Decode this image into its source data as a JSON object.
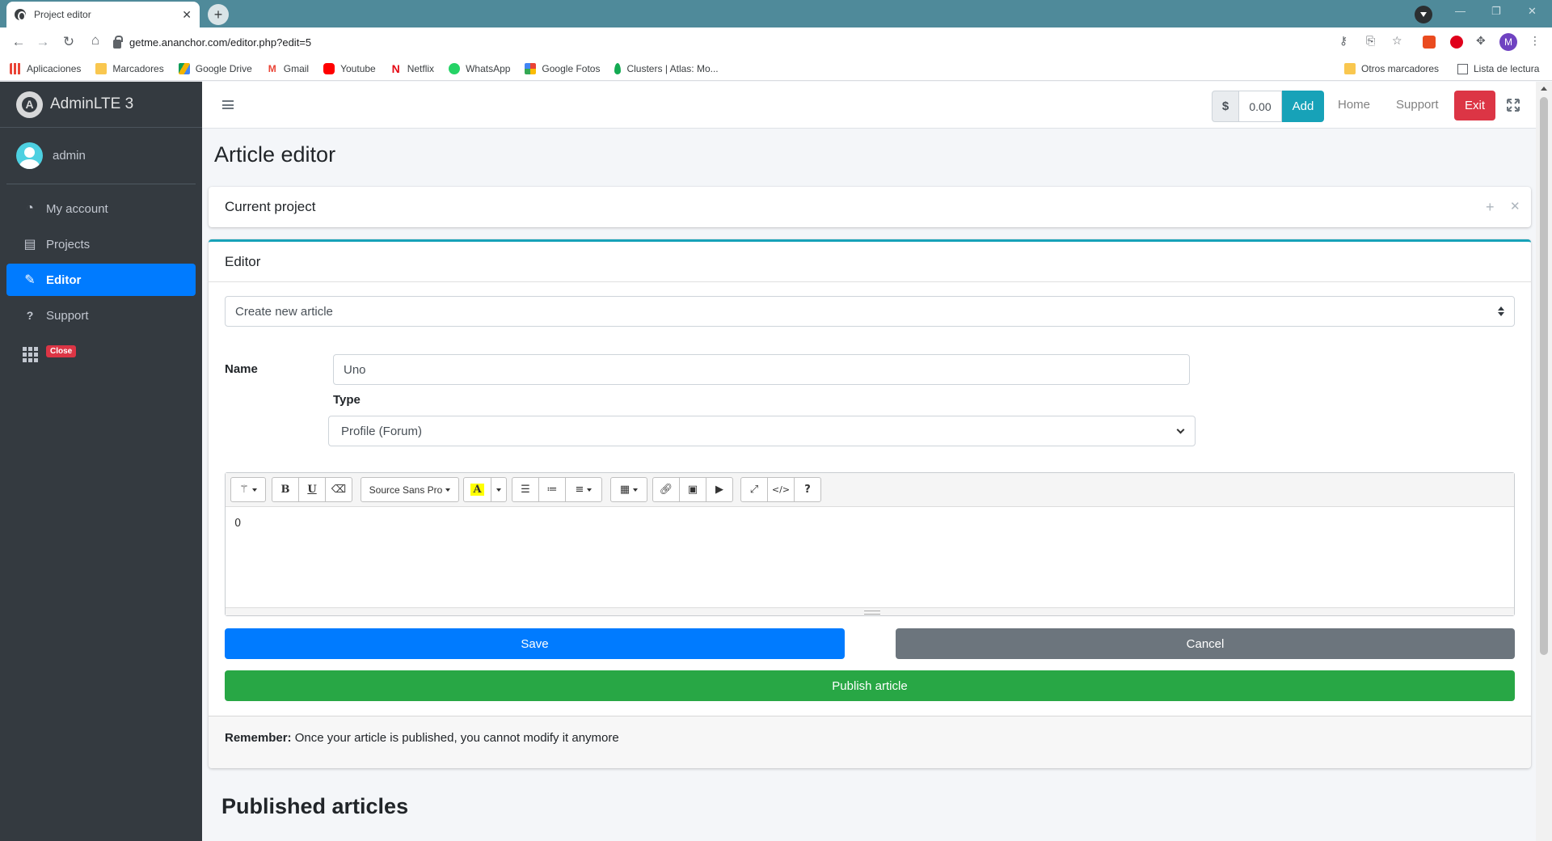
{
  "browser": {
    "tab_title": "Project editor",
    "url": "getme.ananchor.com/editor.php?edit=5",
    "bookmarks": [
      "Aplicaciones",
      "Marcadores",
      "Google Drive",
      "Gmail",
      "Youtube",
      "Netflix",
      "WhatsApp",
      "Google Fotos",
      "Clusters | Atlas: Mo..."
    ],
    "bookmarks_right": [
      "Otros marcadores",
      "Lista de lectura"
    ],
    "profile_initial": "M"
  },
  "sidebar": {
    "brand": "AdminLTE 3",
    "user": "admin",
    "items": [
      {
        "label": "My account"
      },
      {
        "label": "Projects"
      },
      {
        "label": "Editor"
      },
      {
        "label": "Support"
      },
      {
        "label": "Close"
      }
    ]
  },
  "topnav": {
    "currency": "$",
    "balance": "0.00",
    "add_label": "Add",
    "home_label": "Home",
    "support_label": "Support",
    "exit_label": "Exit"
  },
  "page": {
    "title": "Article editor",
    "current_project_header": "Current project",
    "editor_header": "Editor",
    "article_select": "Create new article",
    "name_label": "Name",
    "name_value": "Uno",
    "type_label": "Type",
    "type_value": "Profile (Forum)",
    "font_name": "Source Sans Pro",
    "editor_content": "0",
    "save_label": "Save",
    "cancel_label": "Cancel",
    "publish_label": "Publish article",
    "remember_label": "Remember:",
    "remember_text": " Once your article is published, you cannot modify it anymore",
    "published_title": "Published articles"
  },
  "colors": {
    "primary": "#007bff",
    "secondary": "#6c757d",
    "success": "#28a745",
    "danger": "#dc3545",
    "info": "#17a2b8",
    "sidebar_bg": "#343a40"
  }
}
